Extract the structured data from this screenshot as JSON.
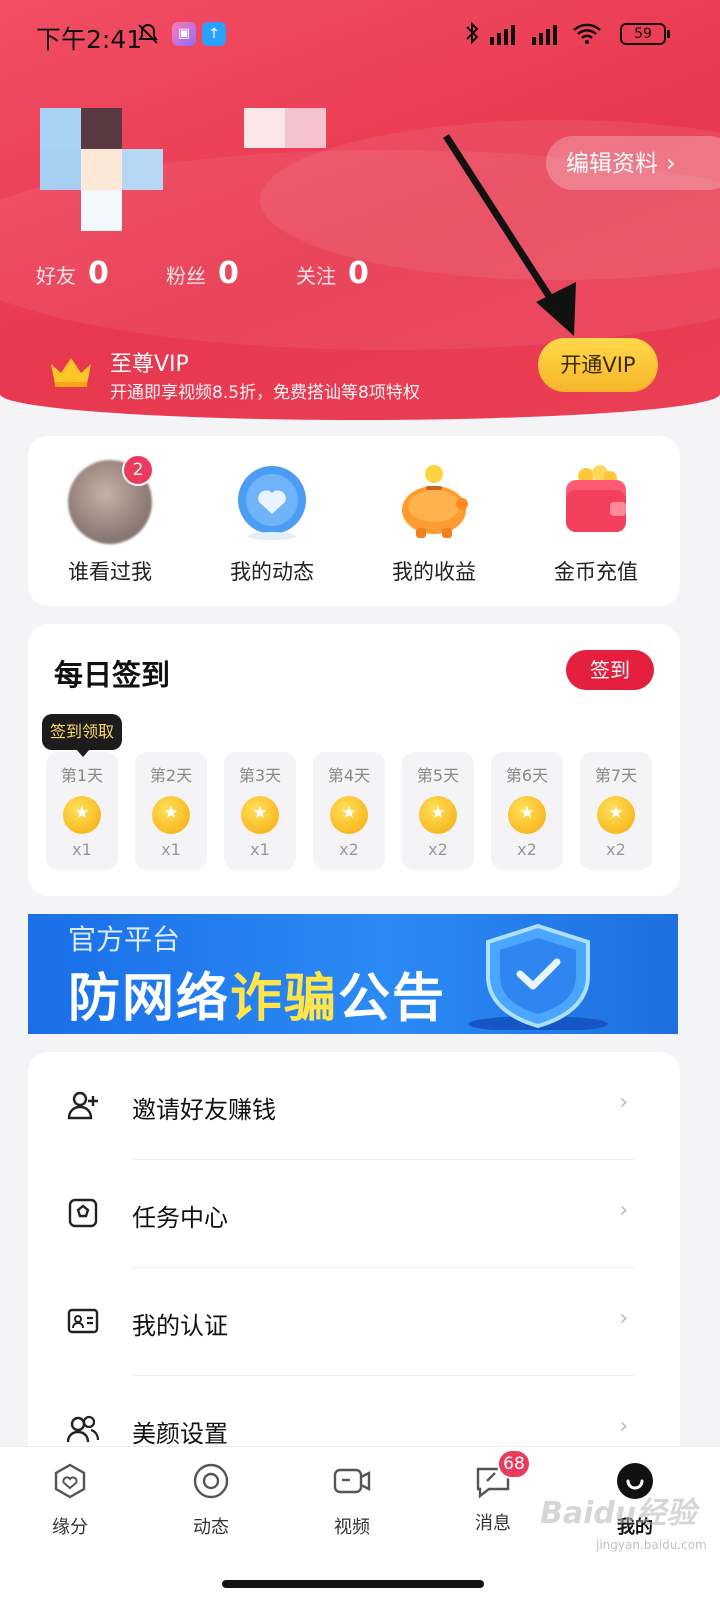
{
  "status_bar": {
    "time": "下午2:41",
    "battery": "59"
  },
  "profile": {
    "edit_label": "编辑资料",
    "stats": [
      {
        "label": "好友",
        "value": "0"
      },
      {
        "label": "粉丝",
        "value": "0"
      },
      {
        "label": "关注",
        "value": "0"
      }
    ]
  },
  "vip": {
    "title": "至尊VIP",
    "desc": "开通即享视频8.5折，免费搭讪等8项特权",
    "button": "开通VIP"
  },
  "shortcuts": [
    {
      "label": "谁看过我",
      "badge": "2",
      "icon": "visitor-avatar-icon"
    },
    {
      "label": "我的动态",
      "icon": "heart-bubble-icon"
    },
    {
      "label": "我的收益",
      "icon": "piggy-bank-icon"
    },
    {
      "label": "金币充值",
      "icon": "wallet-icon"
    }
  ],
  "signin": {
    "title": "每日签到",
    "button": "签到",
    "tooltip": "签到领取",
    "days": [
      {
        "label": "第1天",
        "reward": "x1"
      },
      {
        "label": "第2天",
        "reward": "x1"
      },
      {
        "label": "第3天",
        "reward": "x1"
      },
      {
        "label": "第4天",
        "reward": "x2"
      },
      {
        "label": "第5天",
        "reward": "x2"
      },
      {
        "label": "第6天",
        "reward": "x2"
      },
      {
        "label": "第7天",
        "reward": "x2"
      }
    ]
  },
  "banner": {
    "sub": "官方平台",
    "main_a": "防网络",
    "main_b": "诈骗",
    "main_c": "公告"
  },
  "menu": [
    {
      "label": "邀请好友赚钱",
      "icon": "invite-user-icon"
    },
    {
      "label": "任务中心",
      "icon": "task-icon"
    },
    {
      "label": "我的认证",
      "icon": "id-card-icon"
    },
    {
      "label": "美颜设置",
      "icon": "beauty-users-icon"
    }
  ],
  "tabs": [
    {
      "label": "缘分",
      "icon": "fate-icon"
    },
    {
      "label": "动态",
      "icon": "moments-icon"
    },
    {
      "label": "视频",
      "icon": "video-icon"
    },
    {
      "label": "消息",
      "icon": "message-icon",
      "badge": "68"
    },
    {
      "label": "我的",
      "icon": "me-icon",
      "active": true
    }
  ],
  "watermark": "Baidu经验",
  "watermark_sub": "jingyan.baidu.com"
}
